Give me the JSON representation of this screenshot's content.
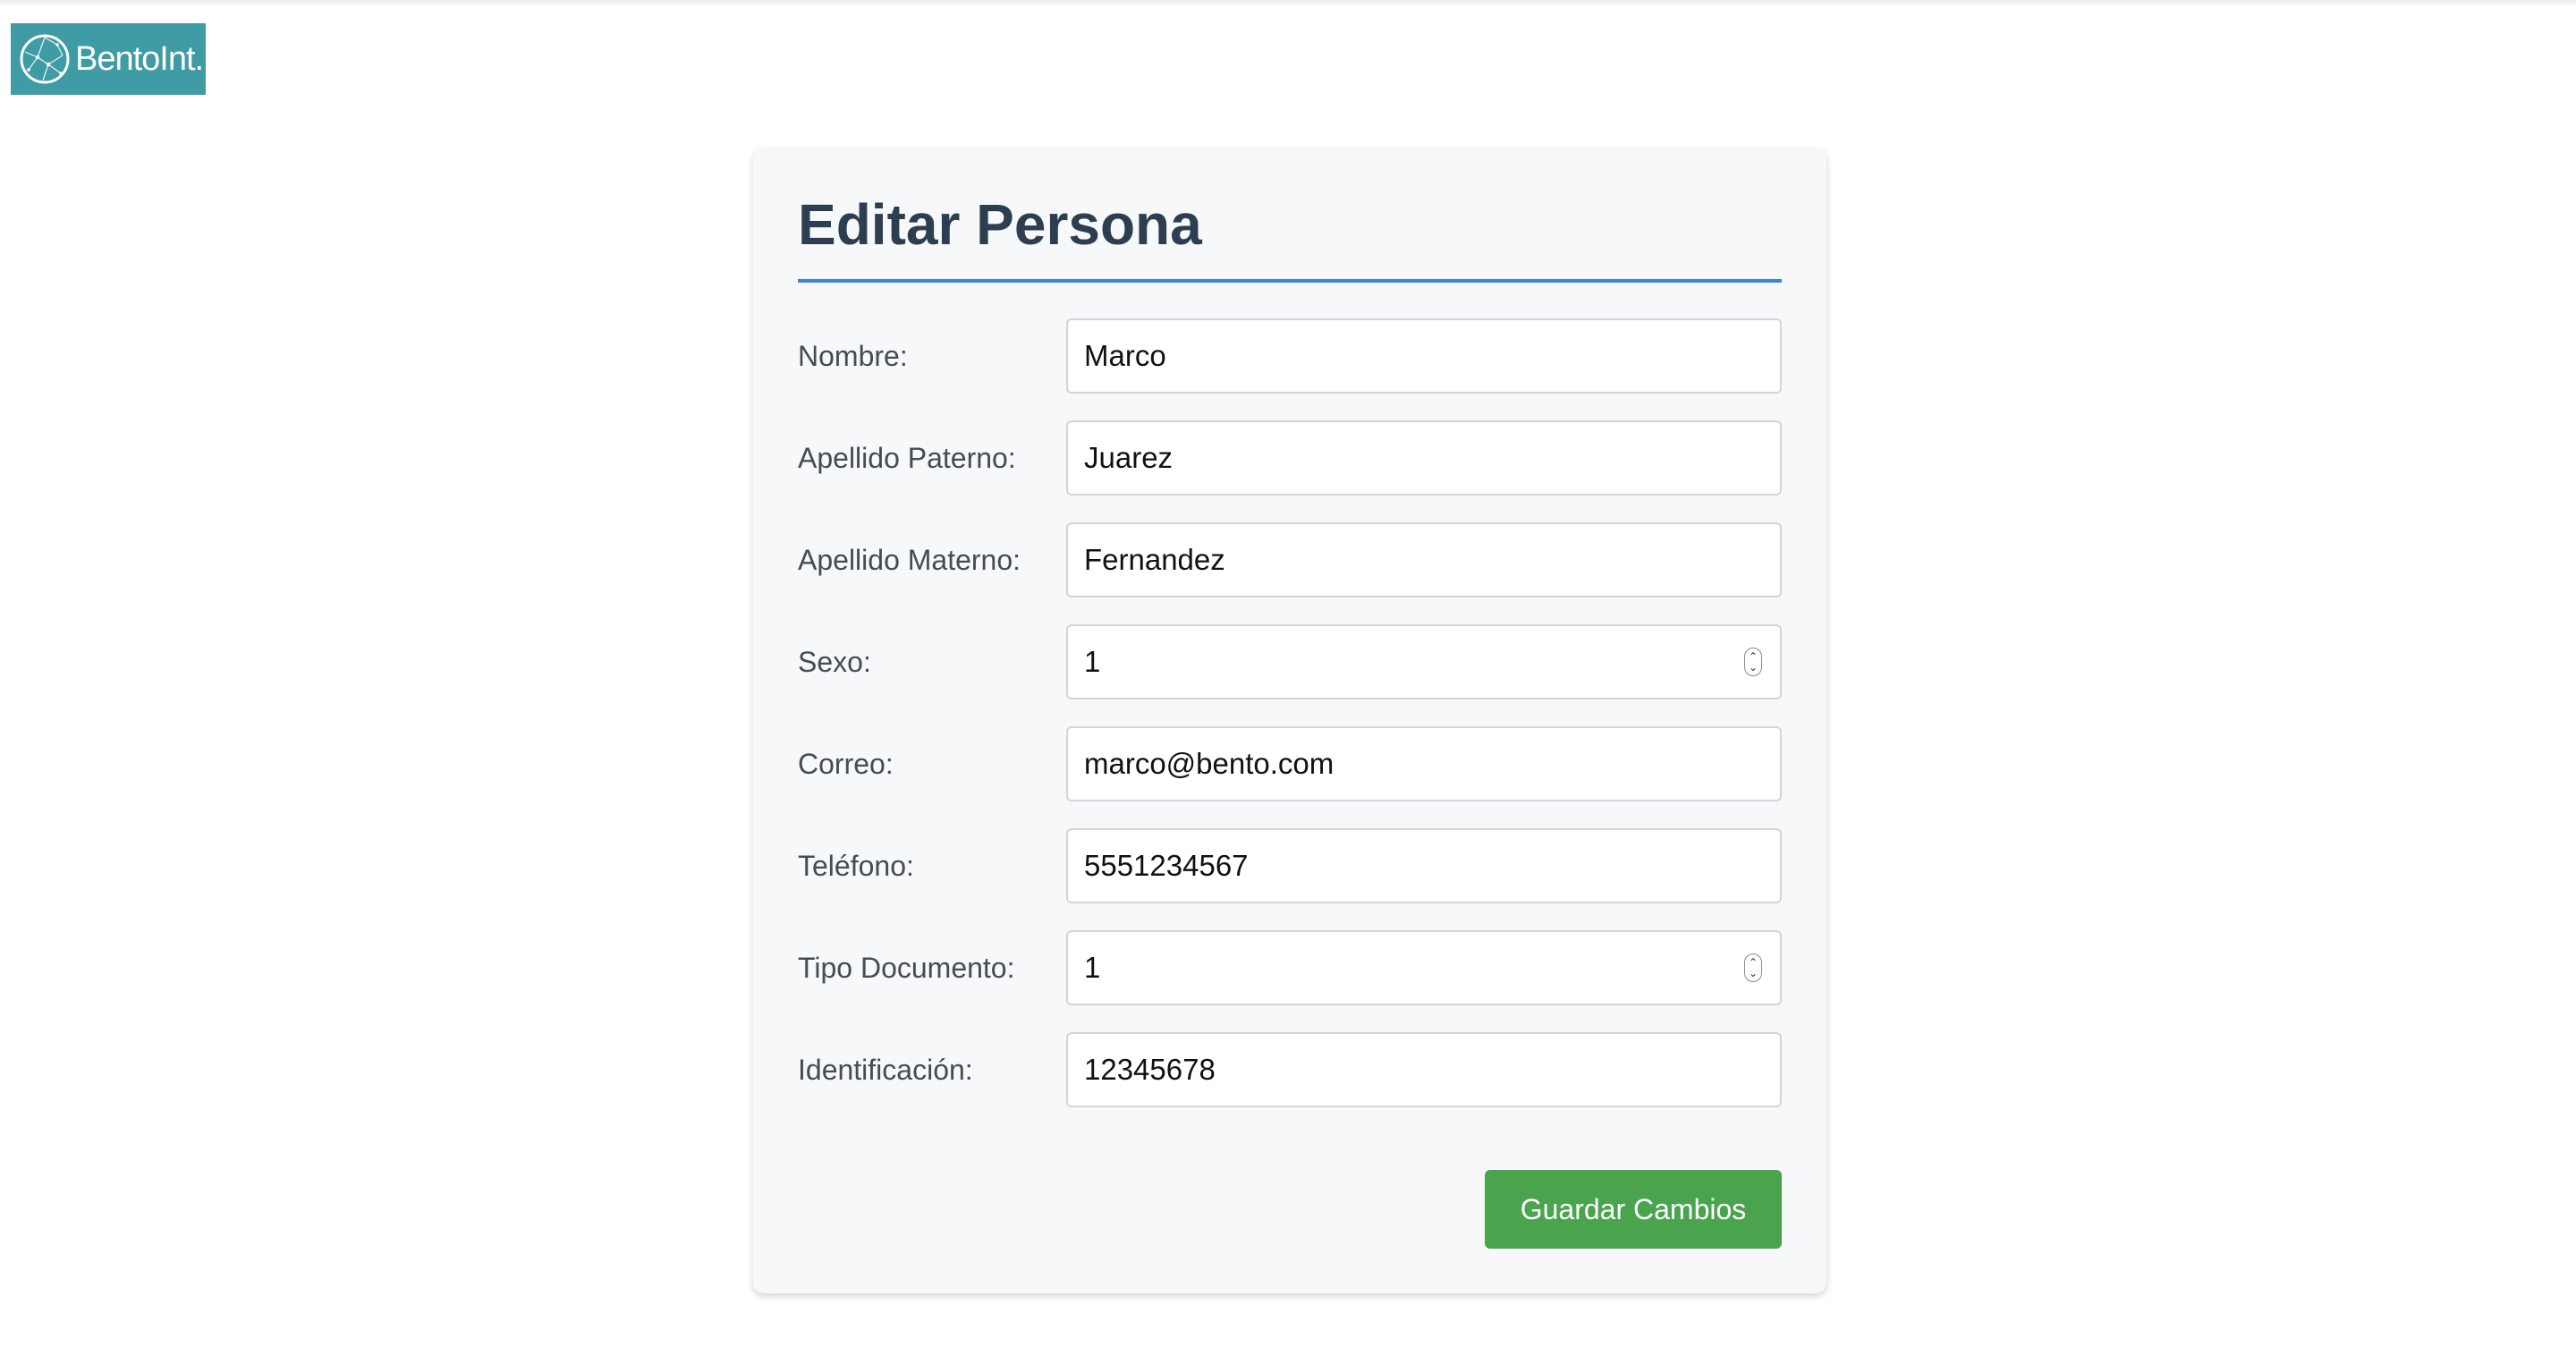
{
  "brand": {
    "name": "BentoInt.",
    "background_color": "#3f9ba4",
    "icon": "network-globe-icon"
  },
  "form": {
    "title": "Editar Persona",
    "accent_color": "#3b86d0",
    "fields": [
      {
        "label": "Nombre:",
        "value": "Marco",
        "type": "text"
      },
      {
        "label": "Apellido Paterno:",
        "value": "Juarez",
        "type": "text"
      },
      {
        "label": "Apellido Materno:",
        "value": "Fernandez",
        "type": "text"
      },
      {
        "label": "Sexo:",
        "value": "1",
        "type": "number"
      },
      {
        "label": "Correo:",
        "value": "marco@bento.com",
        "type": "email"
      },
      {
        "label": "Teléfono:",
        "value": "5551234567",
        "type": "text"
      },
      {
        "label": "Tipo Documento:",
        "value": "1",
        "type": "number"
      },
      {
        "label": "Identificación:",
        "value": "12345678",
        "type": "text"
      }
    ],
    "submit_label": "Guardar Cambios",
    "submit_color": "#4aa34d"
  }
}
